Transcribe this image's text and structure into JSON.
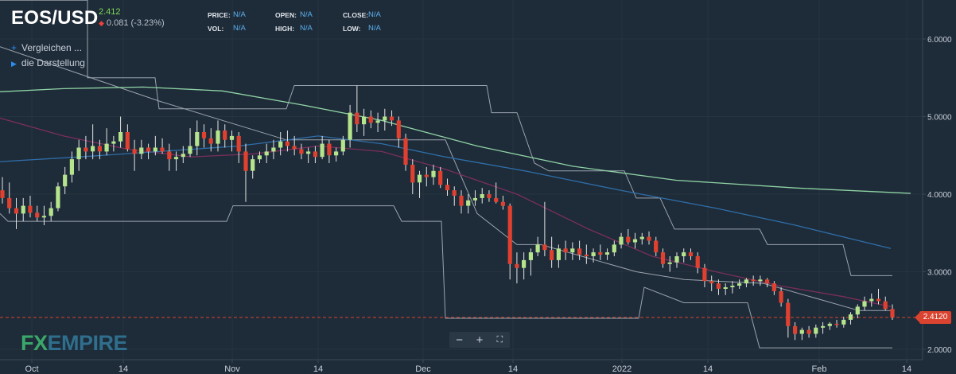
{
  "header": {
    "symbol": "EOS/USD",
    "price": "2.412",
    "change": "0.081 (-3.23%)",
    "stats": [
      {
        "key": "PRICE:",
        "value": "N/A"
      },
      {
        "key": "OPEN:",
        "value": "N/A"
      },
      {
        "key": "CLOSE:",
        "value": "N/A"
      },
      {
        "key": "VOL:",
        "value": "N/A"
      },
      {
        "key": "HIGH:",
        "value": "N/A"
      },
      {
        "key": "LOW:",
        "value": "N/A"
      }
    ]
  },
  "sidebar": {
    "compare_label": "Vergleichen ...",
    "display_label": "die Darstellung"
  },
  "logo": {
    "fx": "FX",
    "empire": "EMPIRE"
  },
  "zoom": {
    "minus": "−",
    "plus": "+",
    "fit": "⛶"
  },
  "price_label": "2.4120",
  "colors": {
    "background": "#1e2b38",
    "up": "#b5e48c",
    "down": "#e0402f",
    "ma_green": "#8fd3a5",
    "ma_blue": "#2f6ea8",
    "ma_purple": "#7a2f5c",
    "channel": "#9aa4ae",
    "price_line": "#d9432f"
  },
  "chart_data": {
    "type": "candlestick",
    "y_ticks": [
      "2.0000",
      "3.0000",
      "4.0000",
      "5.0000",
      "6.0000"
    ],
    "x_ticks": [
      "Oct",
      "14",
      "Nov",
      "14",
      "Dec",
      "14",
      "2022",
      "14",
      "Feb",
      "14"
    ],
    "ylim": [
      1.98,
      6.3
    ],
    "last_price": 2.412,
    "candles": [
      [
        4.05,
        4.22,
        3.88,
        3.95
      ],
      [
        3.95,
        4.15,
        3.75,
        3.82
      ],
      [
        3.82,
        3.95,
        3.55,
        3.75
      ],
      [
        3.75,
        3.95,
        3.65,
        3.85
      ],
      [
        3.85,
        3.98,
        3.7,
        3.76
      ],
      [
        3.76,
        3.85,
        3.65,
        3.7
      ],
      [
        3.7,
        3.85,
        3.6,
        3.72
      ],
      [
        3.72,
        3.9,
        3.65,
        3.82
      ],
      [
        3.82,
        4.15,
        3.78,
        4.1
      ],
      [
        4.1,
        4.35,
        4.0,
        4.25
      ],
      [
        4.25,
        4.55,
        4.15,
        4.45
      ],
      [
        4.45,
        4.7,
        4.3,
        4.6
      ],
      [
        4.6,
        4.75,
        4.45,
        4.55
      ],
      [
        4.55,
        4.9,
        4.45,
        4.62
      ],
      [
        4.62,
        4.7,
        4.45,
        4.55
      ],
      [
        4.55,
        4.85,
        4.5,
        4.65
      ],
      [
        4.65,
        4.75,
        4.55,
        4.68
      ],
      [
        4.68,
        5.0,
        4.6,
        4.8
      ],
      [
        4.8,
        4.9,
        4.55,
        4.58
      ],
      [
        4.58,
        4.7,
        4.3,
        4.52
      ],
      [
        4.52,
        4.7,
        4.45,
        4.6
      ],
      [
        4.6,
        4.65,
        4.45,
        4.55
      ],
      [
        4.55,
        4.75,
        4.5,
        4.6
      ],
      [
        4.6,
        4.72,
        4.52,
        4.55
      ],
      [
        4.55,
        4.65,
        4.3,
        4.45
      ],
      [
        4.45,
        4.55,
        4.3,
        4.48
      ],
      [
        4.48,
        4.62,
        4.4,
        4.52
      ],
      [
        4.52,
        4.85,
        4.48,
        4.62
      ],
      [
        4.62,
        4.95,
        4.5,
        4.8
      ],
      [
        4.8,
        4.9,
        4.6,
        4.72
      ],
      [
        4.72,
        4.85,
        4.55,
        4.65
      ],
      [
        4.65,
        4.95,
        4.55,
        4.82
      ],
      [
        4.82,
        4.9,
        4.6,
        4.7
      ],
      [
        4.7,
        4.82,
        4.55,
        4.75
      ],
      [
        4.75,
        4.8,
        4.4,
        4.55
      ],
      [
        4.55,
        4.65,
        3.9,
        4.3
      ],
      [
        4.3,
        4.5,
        4.2,
        4.45
      ],
      [
        4.45,
        4.55,
        4.4,
        4.5
      ],
      [
        4.5,
        4.65,
        4.4,
        4.55
      ],
      [
        4.55,
        4.7,
        4.45,
        4.6
      ],
      [
        4.6,
        4.8,
        4.5,
        4.68
      ],
      [
        4.68,
        4.82,
        4.55,
        4.62
      ],
      [
        4.62,
        4.75,
        4.5,
        4.58
      ],
      [
        4.58,
        4.65,
        4.45,
        4.52
      ],
      [
        4.52,
        4.6,
        4.4,
        4.55
      ],
      [
        4.55,
        4.62,
        4.4,
        4.48
      ],
      [
        4.48,
        4.75,
        4.45,
        4.65
      ],
      [
        4.65,
        4.7,
        4.4,
        4.5
      ],
      [
        4.5,
        4.6,
        4.42,
        4.55
      ],
      [
        4.55,
        4.75,
        4.5,
        4.7
      ],
      [
        4.7,
        5.15,
        4.6,
        5.05
      ],
      [
        5.05,
        5.4,
        4.8,
        4.9
      ],
      [
        4.9,
        5.1,
        4.75,
        5.0
      ],
      [
        5.0,
        5.08,
        4.85,
        4.92
      ],
      [
        4.92,
        5.05,
        4.8,
        4.95
      ],
      [
        4.95,
        5.1,
        4.82,
        5.0
      ],
      [
        5.0,
        5.08,
        4.88,
        4.95
      ],
      [
        4.95,
        5.0,
        4.6,
        4.72
      ],
      [
        4.72,
        4.78,
        4.3,
        4.38
      ],
      [
        4.38,
        4.45,
        4.0,
        4.15
      ],
      [
        4.15,
        4.3,
        3.95,
        4.25
      ],
      [
        4.25,
        4.35,
        4.1,
        4.22
      ],
      [
        4.22,
        4.38,
        4.12,
        4.3
      ],
      [
        4.3,
        4.35,
        4.08,
        4.12
      ],
      [
        4.12,
        4.2,
        3.98,
        4.05
      ],
      [
        4.05,
        4.1,
        3.85,
        3.98
      ],
      [
        3.98,
        4.05,
        3.75,
        3.85
      ],
      [
        3.85,
        4.0,
        3.75,
        3.92
      ],
      [
        3.92,
        4.05,
        3.85,
        3.95
      ],
      [
        3.95,
        4.08,
        3.88,
        4.0
      ],
      [
        4.0,
        4.05,
        3.9,
        3.95
      ],
      [
        3.95,
        4.15,
        3.88,
        3.9
      ],
      [
        3.9,
        3.98,
        3.8,
        3.85
      ],
      [
        3.85,
        3.88,
        2.9,
        3.1
      ],
      [
        3.1,
        3.25,
        2.85,
        3.05
      ],
      [
        3.05,
        3.25,
        2.9,
        3.15
      ],
      [
        3.15,
        3.3,
        2.95,
        3.25
      ],
      [
        3.25,
        3.45,
        3.2,
        3.35
      ],
      [
        3.35,
        3.9,
        3.2,
        3.28
      ],
      [
        3.28,
        3.45,
        3.05,
        3.15
      ],
      [
        3.15,
        3.35,
        3.05,
        3.3
      ],
      [
        3.3,
        3.4,
        3.15,
        3.25
      ],
      [
        3.25,
        3.38,
        3.15,
        3.3
      ],
      [
        3.3,
        3.4,
        3.15,
        3.22
      ],
      [
        3.22,
        3.35,
        3.1,
        3.2
      ],
      [
        3.2,
        3.3,
        3.12,
        3.25
      ],
      [
        3.25,
        3.35,
        3.15,
        3.22
      ],
      [
        3.22,
        3.3,
        3.15,
        3.25
      ],
      [
        3.25,
        3.4,
        3.2,
        3.35
      ],
      [
        3.35,
        3.5,
        3.3,
        3.45
      ],
      [
        3.45,
        3.55,
        3.35,
        3.38
      ],
      [
        3.38,
        3.5,
        3.3,
        3.42
      ],
      [
        3.42,
        3.5,
        3.35,
        3.45
      ],
      [
        3.45,
        3.52,
        3.35,
        3.4
      ],
      [
        3.4,
        3.45,
        3.2,
        3.25
      ],
      [
        3.25,
        3.3,
        3.05,
        3.1
      ],
      [
        3.1,
        3.2,
        3.0,
        3.12
      ],
      [
        3.12,
        3.25,
        3.05,
        3.2
      ],
      [
        3.2,
        3.3,
        3.12,
        3.25
      ],
      [
        3.25,
        3.3,
        3.15,
        3.2
      ],
      [
        3.2,
        3.25,
        2.98,
        3.05
      ],
      [
        3.05,
        3.1,
        2.8,
        2.88
      ],
      [
        2.88,
        2.95,
        2.75,
        2.85
      ],
      [
        2.85,
        2.9,
        2.7,
        2.78
      ],
      [
        2.78,
        2.85,
        2.7,
        2.8
      ],
      [
        2.8,
        2.88,
        2.72,
        2.82
      ],
      [
        2.82,
        2.9,
        2.78,
        2.85
      ],
      [
        2.85,
        2.92,
        2.8,
        2.9
      ],
      [
        2.9,
        2.95,
        2.82,
        2.88
      ],
      [
        2.88,
        2.95,
        2.82,
        2.9
      ],
      [
        2.9,
        2.92,
        2.8,
        2.85
      ],
      [
        2.85,
        2.88,
        2.7,
        2.75
      ],
      [
        2.75,
        2.8,
        2.55,
        2.6
      ],
      [
        2.6,
        2.65,
        2.15,
        2.3
      ],
      [
        2.3,
        2.35,
        2.12,
        2.2
      ],
      [
        2.2,
        2.28,
        2.12,
        2.25
      ],
      [
        2.25,
        2.3,
        2.15,
        2.2
      ],
      [
        2.2,
        2.32,
        2.15,
        2.28
      ],
      [
        2.28,
        2.35,
        2.2,
        2.3
      ],
      [
        2.3,
        2.35,
        2.25,
        2.33
      ],
      [
        2.33,
        2.38,
        2.28,
        2.32
      ],
      [
        2.32,
        2.42,
        2.28,
        2.38
      ],
      [
        2.38,
        2.48,
        2.32,
        2.45
      ],
      [
        2.45,
        2.58,
        2.4,
        2.55
      ],
      [
        2.55,
        2.68,
        2.5,
        2.62
      ],
      [
        2.62,
        2.72,
        2.55,
        2.65
      ],
      [
        2.65,
        2.78,
        2.58,
        2.62
      ],
      [
        2.62,
        2.68,
        2.5,
        2.52
      ],
      [
        2.52,
        2.58,
        2.38,
        2.41
      ]
    ],
    "ma_green": [
      [
        0,
        5.32
      ],
      [
        80,
        5.36
      ],
      [
        180,
        5.38
      ],
      [
        280,
        5.33
      ],
      [
        380,
        5.15
      ],
      [
        480,
        4.95
      ],
      [
        600,
        4.62
      ],
      [
        720,
        4.36
      ],
      [
        850,
        4.18
      ],
      [
        1000,
        4.08
      ],
      [
        1145,
        4.01
      ]
    ],
    "ma_blue": [
      [
        0,
        4.42
      ],
      [
        100,
        4.48
      ],
      [
        200,
        4.55
      ],
      [
        300,
        4.62
      ],
      [
        400,
        4.75
      ],
      [
        480,
        4.65
      ],
      [
        560,
        4.48
      ],
      [
        660,
        4.3
      ],
      [
        780,
        4.05
      ],
      [
        900,
        3.82
      ],
      [
        1000,
        3.6
      ],
      [
        1120,
        3.3
      ]
    ],
    "ma_purple": [
      [
        0,
        4.98
      ],
      [
        80,
        4.75
      ],
      [
        160,
        4.58
      ],
      [
        240,
        4.48
      ],
      [
        320,
        4.52
      ],
      [
        400,
        4.62
      ],
      [
        480,
        4.55
      ],
      [
        560,
        4.32
      ],
      [
        650,
        4.0
      ],
      [
        740,
        3.55
      ],
      [
        820,
        3.2
      ],
      [
        900,
        3.0
      ],
      [
        980,
        2.82
      ],
      [
        1060,
        2.68
      ],
      [
        1120,
        2.55
      ]
    ],
    "channel_upper": [
      [
        0,
        6.5
      ],
      [
        110,
        6.5
      ],
      [
        110,
        5.5
      ],
      [
        195,
        5.5
      ],
      [
        200,
        5.1
      ],
      [
        360,
        5.1
      ],
      [
        370,
        5.4
      ],
      [
        612,
        5.4
      ],
      [
        618,
        5.05
      ],
      [
        650,
        5.05
      ],
      [
        672,
        4.4
      ],
      [
        690,
        4.3
      ],
      [
        785,
        4.3
      ],
      [
        800,
        3.95
      ],
      [
        830,
        3.95
      ],
      [
        848,
        3.55
      ],
      [
        955,
        3.55
      ],
      [
        965,
        3.35
      ],
      [
        1060,
        3.35
      ],
      [
        1070,
        2.95
      ],
      [
        1122,
        2.95
      ]
    ],
    "channel_lower": [
      [
        0,
        3.75
      ],
      [
        10,
        3.65
      ],
      [
        285,
        3.65
      ],
      [
        293,
        3.85
      ],
      [
        495,
        3.85
      ],
      [
        505,
        3.65
      ],
      [
        555,
        3.65
      ],
      [
        560,
        2.4
      ],
      [
        803,
        2.4
      ],
      [
        810,
        2.8
      ],
      [
        860,
        2.6
      ],
      [
        940,
        2.6
      ],
      [
        955,
        2.02
      ],
      [
        1122,
        2.02
      ]
    ],
    "channel_mid": [
      [
        0,
        5.9
      ],
      [
        200,
        5.2
      ],
      [
        360,
        4.7
      ],
      [
        560,
        4.7
      ],
      [
        600,
        3.75
      ],
      [
        650,
        3.35
      ],
      [
        680,
        3.35
      ],
      [
        800,
        3.0
      ],
      [
        860,
        2.9
      ],
      [
        960,
        2.85
      ],
      [
        1080,
        2.5
      ],
      [
        1122,
        2.5
      ]
    ]
  }
}
